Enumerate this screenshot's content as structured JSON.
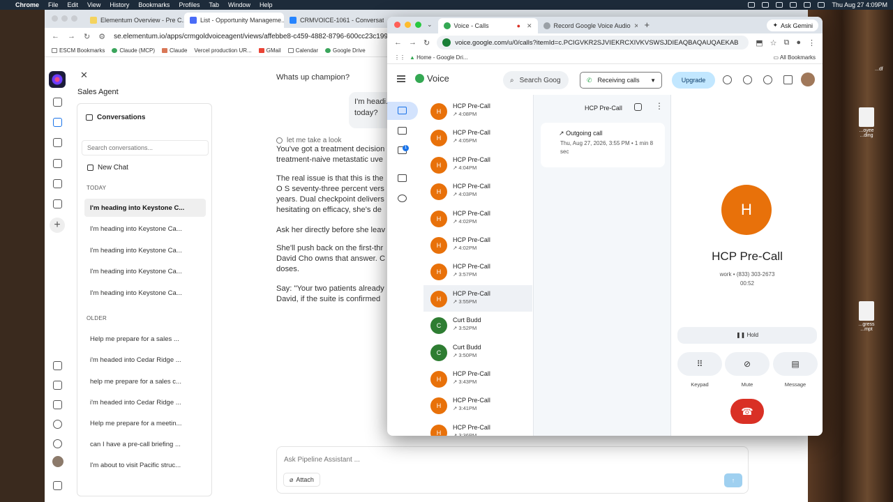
{
  "menubar": {
    "app": "Chrome",
    "items": [
      "File",
      "Edit",
      "View",
      "History",
      "Bookmarks",
      "Profiles",
      "Tab",
      "Window",
      "Help"
    ],
    "clock": "Thu Aug 27  4:09PM"
  },
  "desktop": {
    "files": [
      "...oyee\n...ding",
      "...gress\n...mpt"
    ],
    "edge_text": "...df"
  },
  "browser1": {
    "tabs": [
      {
        "title": "Elementum Overview - Pre C..."
      },
      {
        "title": "List - Opportunity Manageme..."
      },
      {
        "title": "CRMVOICE-1061 - Conversat..."
      }
    ],
    "url": "se.elementum.io/apps/crmgoldvoiceagent/views/affebbe8-c459-4882-8796-600cc23c1992/conver",
    "bookmarks": [
      "ESCM Bookmarks",
      "Claude (MCP)",
      "Claude",
      "Vercel production UR...",
      "GMail",
      "Calendar",
      "Google Drive"
    ]
  },
  "sales_agent": {
    "title": "Sales Agent",
    "conversations_header": "Conversations",
    "search_placeholder": "Search conversations...",
    "new_chat": "New Chat",
    "today_label": "TODAY",
    "today_items": [
      "I'm heading into Keystone C...",
      "I'm heading into Keystone Ca...",
      "I'm heading into Keystone Ca...",
      "I'm heading into Keystone Ca...",
      "I'm heading into Keystone Ca..."
    ],
    "older_label": "OLDER",
    "older_items": [
      "Help me prepare for a sales ...",
      "i'm headed into Cedar Ridge ...",
      "help me prepare for a sales c...",
      "i'm headed into Cedar Ridge ...",
      "Help me prepare for a meetin...",
      "can I have a pre-call briefing ...",
      "I'm about to visit Pacific struc..."
    ]
  },
  "chat": {
    "greeting": "Whats up champion?",
    "user_message": "I'm headi...\ntoday?",
    "thinking": "let me take a look",
    "paragraphs": [
      "You've got a treatment decision\ntreatment-naive metastatic uve",
      "The real issue is that this is the\nO S seventy-three percent vers\nyears. Dual checkpoint delivers\nhesitating on efficacy, she's de",
      "Ask her directly before she leav",
      "She'll push back on the first-thr\nDavid Cho owns that answer. C\ndoses.",
      "Say: \"Your two patients already\nDavid, if the suite is confirmed"
    ],
    "input_placeholder": "Ask Pipeline Assistant ...",
    "attach_label": "Attach"
  },
  "browser2": {
    "tabs": [
      {
        "title": "Voice - Calls"
      },
      {
        "title": "Record Google Voice Audio"
      }
    ],
    "ask_gemini": "Ask Gemini",
    "url": "voice.google.com/u/0/calls?itemId=c.PCIGVKR2SJVIEKRCXIVKVSWSJDIEAQBAQAUQAEKAB",
    "bookmarks": [
      "Home - Google Dri..."
    ],
    "all_bookmarks": "All Bookmarks"
  },
  "voice": {
    "logo": "Voice",
    "search_placeholder": "Search Goog",
    "receiving": "Receiving calls",
    "upgrade": "Upgrade",
    "badge": "1",
    "calls": [
      {
        "name": "HCP Pre-Call",
        "time": "4:08PM",
        "initial": "H",
        "color": "#e8710a"
      },
      {
        "name": "HCP Pre-Call",
        "time": "4:05PM",
        "initial": "H",
        "color": "#e8710a"
      },
      {
        "name": "HCP Pre-Call",
        "time": "4:04PM",
        "initial": "H",
        "color": "#e8710a"
      },
      {
        "name": "HCP Pre-Call",
        "time": "4:03PM",
        "initial": "H",
        "color": "#e8710a"
      },
      {
        "name": "HCP Pre-Call",
        "time": "4:02PM",
        "initial": "H",
        "color": "#e8710a"
      },
      {
        "name": "HCP Pre-Call",
        "time": "4:02PM",
        "initial": "H",
        "color": "#e8710a"
      },
      {
        "name": "HCP Pre-Call",
        "time": "3:57PM",
        "initial": "H",
        "color": "#e8710a"
      },
      {
        "name": "HCP Pre-Call",
        "time": "3:55PM",
        "initial": "H",
        "color": "#e8710a"
      },
      {
        "name": "Curt Budd",
        "time": "3:52PM",
        "initial": "C",
        "color": "#2e7d32"
      },
      {
        "name": "Curt Budd",
        "time": "3:50PM",
        "initial": "C",
        "color": "#2e7d32"
      },
      {
        "name": "HCP Pre-Call",
        "time": "3:43PM",
        "initial": "H",
        "color": "#e8710a"
      },
      {
        "name": "HCP Pre-Call",
        "time": "3:41PM",
        "initial": "H",
        "color": "#e8710a"
      },
      {
        "name": "HCP Pre-Call",
        "time": "3:36PM",
        "initial": "H",
        "color": "#e8710a"
      }
    ],
    "detail": {
      "title": "HCP Pre-Call",
      "call_type": "Outgoing call",
      "call_info": "Thu, Aug 27, 2026, 3:55 PM • 1 min 8 sec"
    },
    "active": {
      "initial": "H",
      "name": "HCP Pre-Call",
      "number": "work • (833) 303-2673",
      "duration": "00:52",
      "hold": "Hold",
      "keypad": "Keypad",
      "mute": "Mute",
      "message": "Message"
    }
  }
}
